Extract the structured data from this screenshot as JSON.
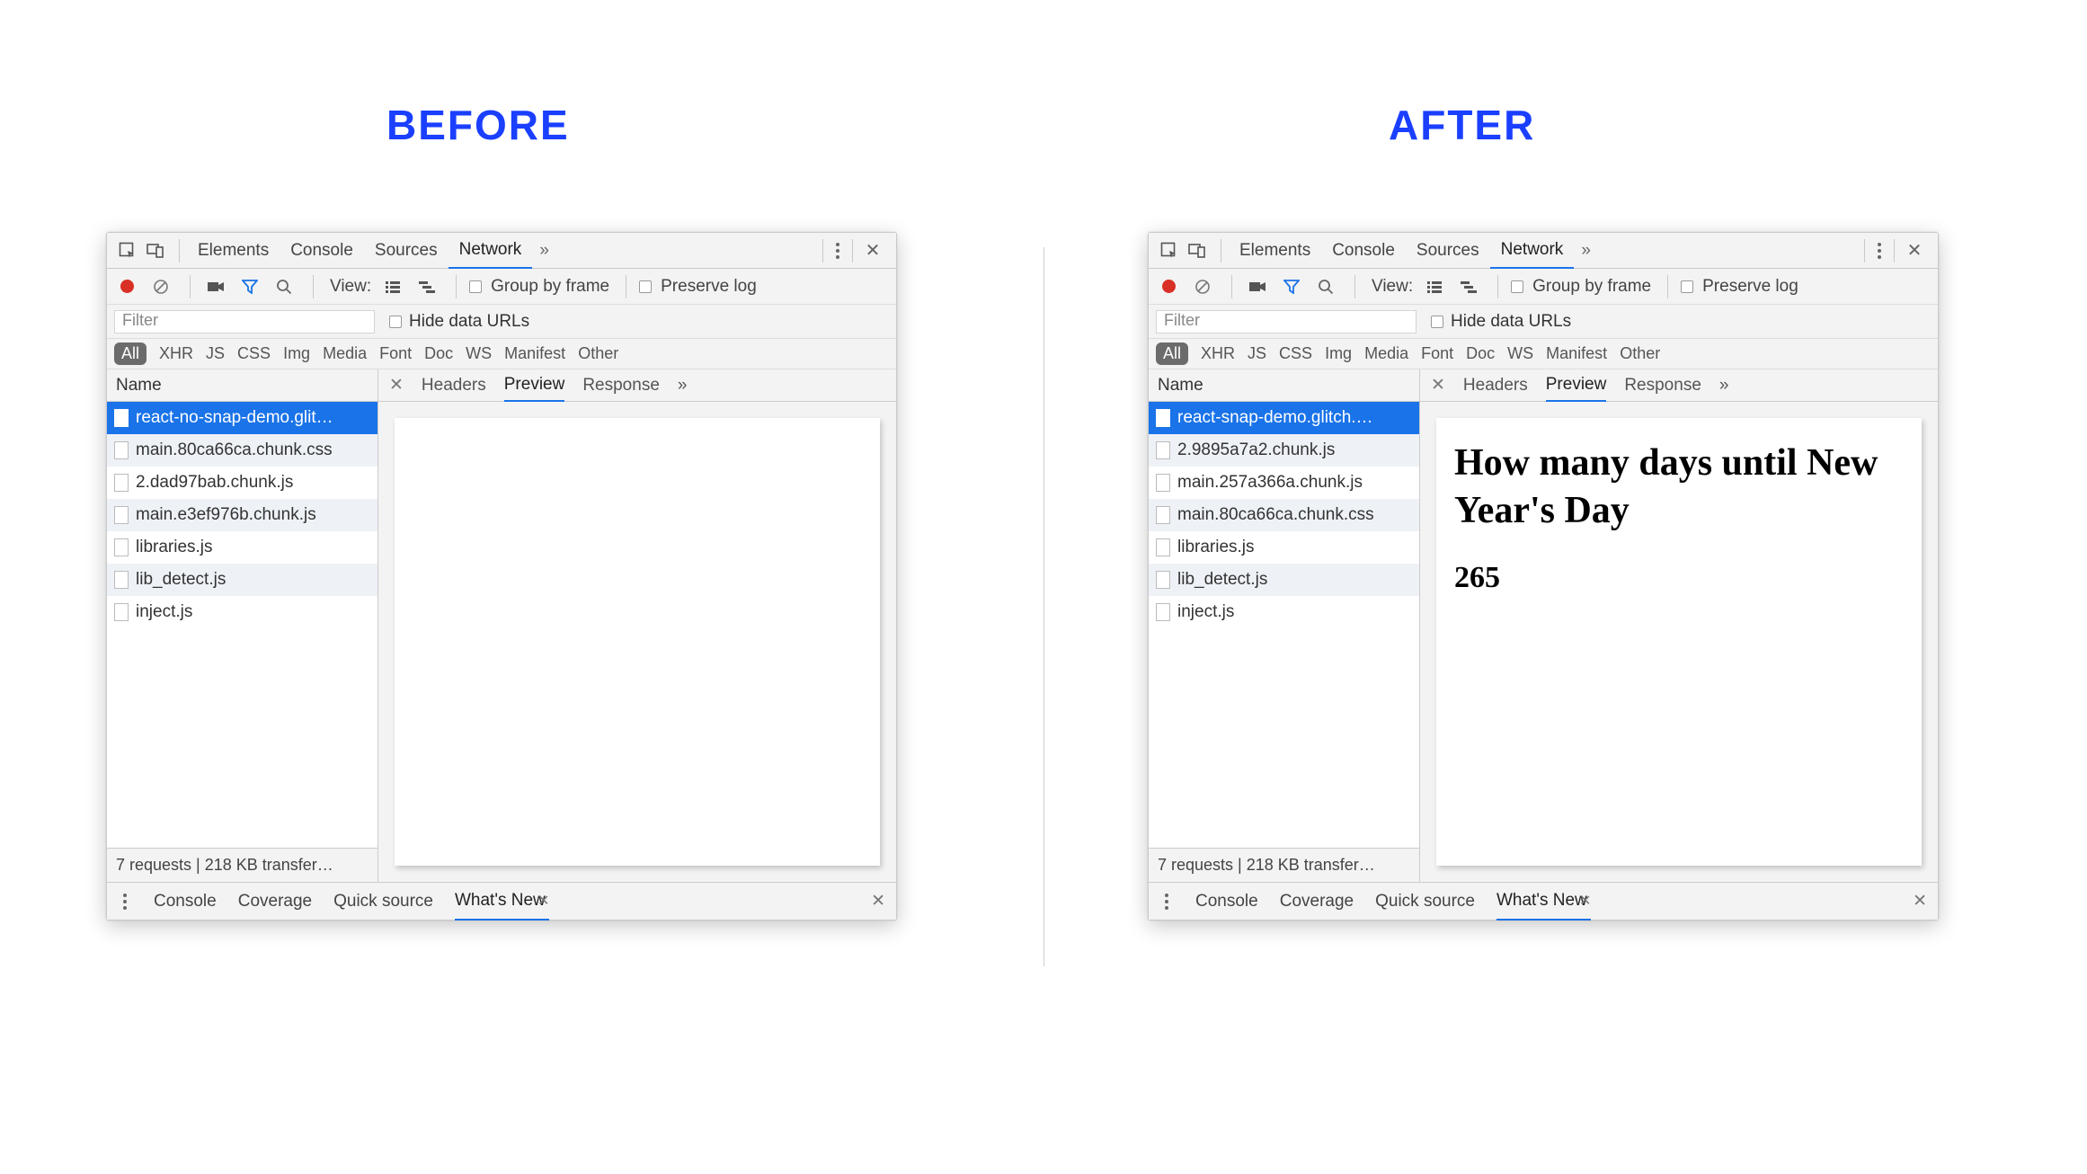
{
  "headings": {
    "before": "BEFORE",
    "after": "AFTER"
  },
  "mainTabs": {
    "elements": "Elements",
    "console": "Console",
    "sources": "Sources",
    "network": "Network"
  },
  "toolbar": {
    "view": "View:",
    "groupByFrame": "Group by frame",
    "preserveLog": "Preserve log"
  },
  "filterRow": {
    "placeholder": "Filter",
    "hideDataURLs": "Hide data URLs"
  },
  "filterTypes": {
    "all": "All",
    "xhr": "XHR",
    "js": "JS",
    "css": "CSS",
    "img": "Img",
    "media": "Media",
    "font": "Font",
    "doc": "Doc",
    "ws": "WS",
    "manifest": "Manifest",
    "other": "Other"
  },
  "columns": {
    "name": "Name"
  },
  "detailTabs": {
    "headers": "Headers",
    "preview": "Preview",
    "response": "Response"
  },
  "status": {
    "text": "7 requests | 218 KB transfer…"
  },
  "drawer": {
    "console": "Console",
    "coverage": "Coverage",
    "quickSource": "Quick source",
    "whatsNew": "What's New"
  },
  "before": {
    "requests": [
      "react-no-snap-demo.glit…",
      "main.80ca66ca.chunk.css",
      "2.dad97bab.chunk.js",
      "main.e3ef976b.chunk.js",
      "libraries.js",
      "lib_detect.js",
      "inject.js"
    ],
    "preview": {
      "title": "",
      "count": ""
    }
  },
  "after": {
    "requests": [
      "react-snap-demo.glitch.…",
      "2.9895a7a2.chunk.js",
      "main.257a366a.chunk.js",
      "main.80ca66ca.chunk.css",
      "libraries.js",
      "lib_detect.js",
      "inject.js"
    ],
    "preview": {
      "title": "How many days until New Year's Day",
      "count": "265"
    }
  }
}
